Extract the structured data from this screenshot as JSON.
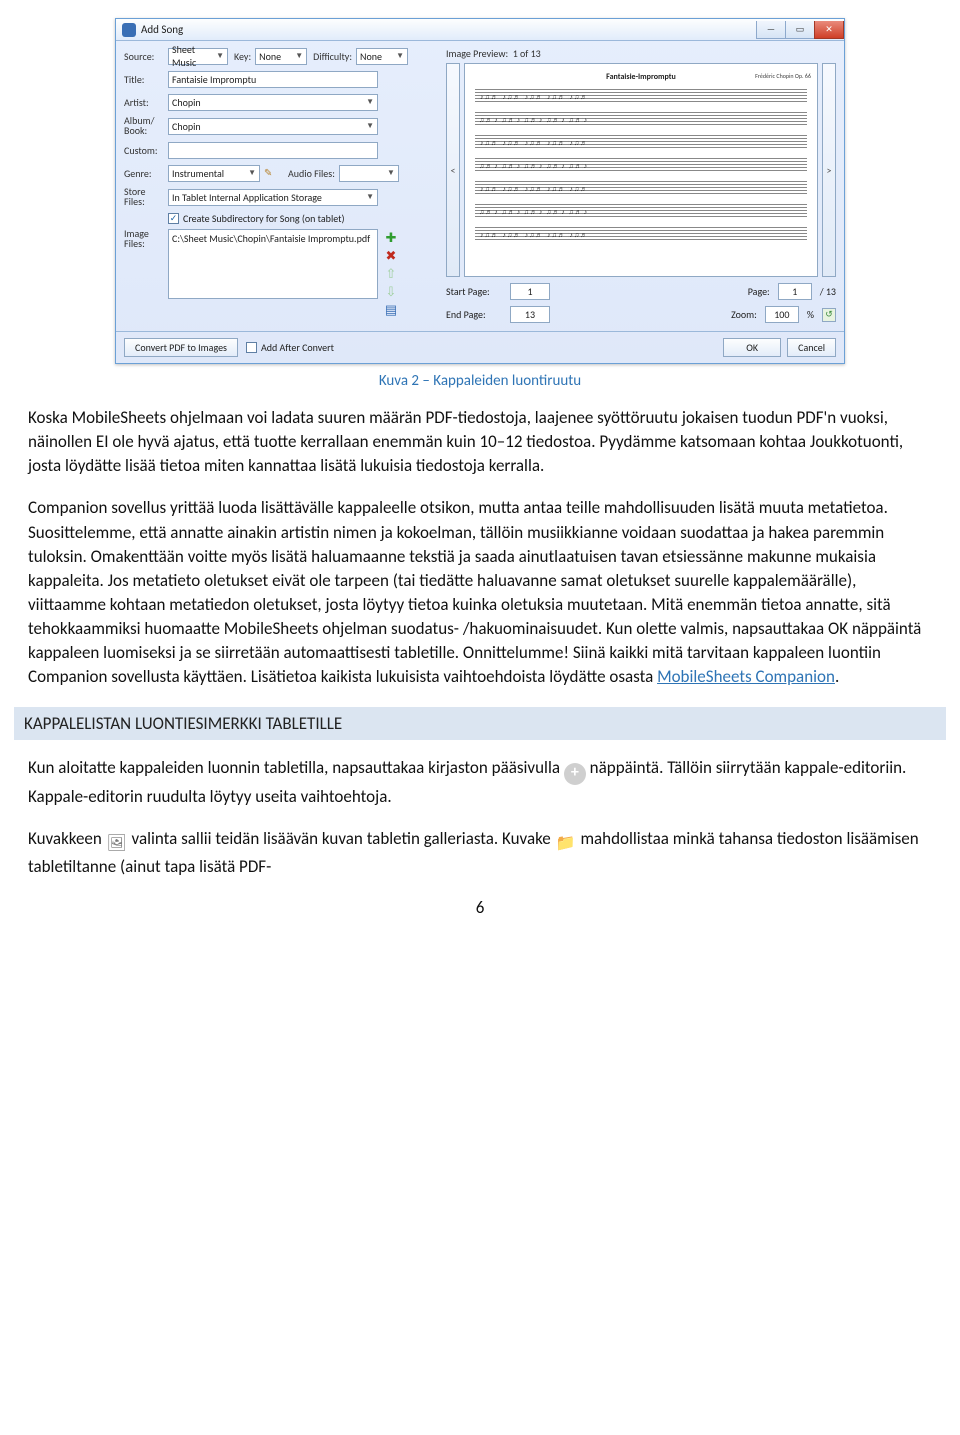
{
  "window": {
    "title": "Add Song",
    "labels": {
      "source": "Source:",
      "key": "Key:",
      "difficulty": "Difficulty:",
      "title": "Title:",
      "artist": "Artist:",
      "album": "Album/\nBook:",
      "custom": "Custom:",
      "genre": "Genre:",
      "audio_files": "Audio Files:",
      "store_files": "Store\nFiles:",
      "create_subdir": "Create Subdirectory for Song (on tablet)",
      "image_files": "Image\nFiles:",
      "image_preview": "Image Preview:",
      "preview_count": "1 of 13",
      "start_page": "Start Page:",
      "end_page": "End Page:",
      "page": "Page:",
      "zoom": "Zoom:",
      "of_pages": "/ 13",
      "zoom_unit": "%"
    },
    "values": {
      "source": "Sheet Music",
      "key": "None",
      "difficulty": "None",
      "title": "Fantaisie Impromptu",
      "artist": "Chopin",
      "album": "Chopin",
      "custom": "",
      "genre": "Instrumental",
      "store_files": "In Tablet Internal Application Storage",
      "image_file": "C:\\Sheet Music\\Chopin\\Fantaisie Impromptu.pdf",
      "checked": "✓",
      "start_page": "1",
      "end_page": "13",
      "page": "1",
      "zoom": "100",
      "sheet_title": "Fantaisie-Impromptu",
      "sheet_composer": "Frédéric Chopin\nOp. 66"
    },
    "buttons": {
      "convert": "Convert PDF to Images",
      "add_after": "Add After Convert",
      "ok": "OK",
      "cancel": "Cancel",
      "nav_prev": "<",
      "nav_next": ">"
    }
  },
  "caption": "Kuva 2 – Kappaleiden luontiruutu",
  "p1": "Koska MobileSheets ohjelmaan voi ladata suuren määrän PDF-tiedostoja, laajenee syöttöruutu jokaisen tuodun PDF'n vuoksi, näinollen EI ole hyvä ajatus, että tuotte kerrallaan enemmän kuin 10–12 tiedostoa. Pyydämme katsomaan kohtaa Joukkotuonti, josta löydätte lisää tietoa miten kannattaa lisätä lukuisia tiedostoja kerralla.",
  "p2a": "Companion sovellus yrittää luoda lisättävälle kappaleelle otsikon, mutta antaa teille mahdollisuuden lisätä muuta metatietoa. Suosittelemme, että annatte ainakin artistin nimen ja kokoelman, tällöin musiikkianne voidaan suodattaa ja hakea paremmin tuloksin. Omakenttään voitte myös lisätä haluamaanne tekstiä ja saada ainutlaatuisen tavan etsiessänne makunne mukaisia kappaleita. Jos metatieto oletukset eivät ole tarpeen (tai tiedätte haluavanne samat oletukset suurelle kappalemäärälle), viittaamme kohtaan metatiedon oletukset, josta löytyy tietoa kuinka oletuksia muutetaan. Mitä enemmän tietoa annatte, sitä tehokkaammiksi huomaatte MobileSheets ohjelman suodatus- /hakuominaisuudet. Kun olette valmis, napsauttakaa OK näppäintä kappaleen luomiseksi ja se siirretään automaattisesti tabletille. Onnittelumme! Siinä kaikki mitä tarvitaan kappaleen luontiin Companion sovellusta käyttäen. Lisätietoa kaikista lukuisista vaihtoehdoista löydätte osasta ",
  "p2link": "MobileSheets Companion",
  "p2b": ".",
  "heading": "KAPPALELISTAN LUONTIESIMERKKI TABLETILLE",
  "p3a": "Kun aloitatte kappaleiden luonnin tabletilla, napsauttakaa kirjaston pääsivulla ",
  "p3b": " näppäintä. Tällöin siirrytään kappale-editoriin. Kappale-editorin ruudulta löytyy useita vaihtoehtoja.",
  "p4a": "Kuvakkeen ",
  "p4b": " valinta sallii teidän lisäävän kuvan tabletin galleriasta. Kuvake ",
  "p4c": " mahdollistaa minkä tahansa tiedoston lisäämisen tabletiltanne (ainut tapa lisätä PDF-",
  "page_number": "6"
}
